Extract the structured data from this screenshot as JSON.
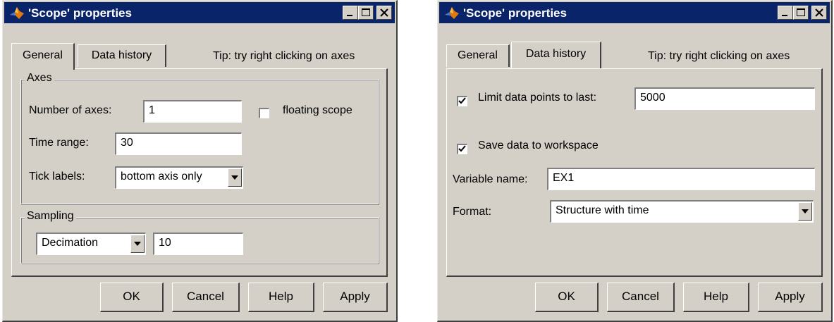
{
  "dialogs": [
    {
      "title": "'Scope' properties",
      "tabs": [
        "General",
        "Data history"
      ],
      "active_tab": "General",
      "tip": "Tip: try right clicking on axes",
      "axes_group": {
        "label": "Axes",
        "number_of_axes_label": "Number of axes:",
        "number_of_axes_value": "1",
        "floating_scope_label": "floating scope",
        "floating_scope_checked": false,
        "time_range_label": "Time range:",
        "time_range_value": "30",
        "tick_labels_label": "Tick labels:",
        "tick_labels_value": "bottom axis only"
      },
      "sampling_group": {
        "label": "Sampling",
        "mode_value": "Decimation",
        "factor_value": "10"
      },
      "buttons": [
        "OK",
        "Cancel",
        "Help",
        "Apply"
      ]
    },
    {
      "title": "'Scope' properties",
      "tabs": [
        "General",
        "Data history"
      ],
      "active_tab": "Data history",
      "tip": "Tip: try right clicking on axes",
      "limit_points_label": "Limit data points to last:",
      "limit_points_checked": true,
      "limit_points_value": "5000",
      "save_to_workspace_label": "Save data to workspace",
      "save_to_workspace_checked": true,
      "variable_name_label": "Variable name:",
      "variable_name_value": "EX1",
      "format_label": "Format:",
      "format_value": "Structure with time",
      "buttons": [
        "OK",
        "Cancel",
        "Help",
        "Apply"
      ]
    }
  ],
  "colors": {
    "title_bar": "#0a246a",
    "face": "#d4d0c8"
  },
  "icons": {
    "app": "matlab-icon",
    "minimize": "minimize-icon",
    "maximize": "maximize-icon",
    "close": "close-icon"
  }
}
